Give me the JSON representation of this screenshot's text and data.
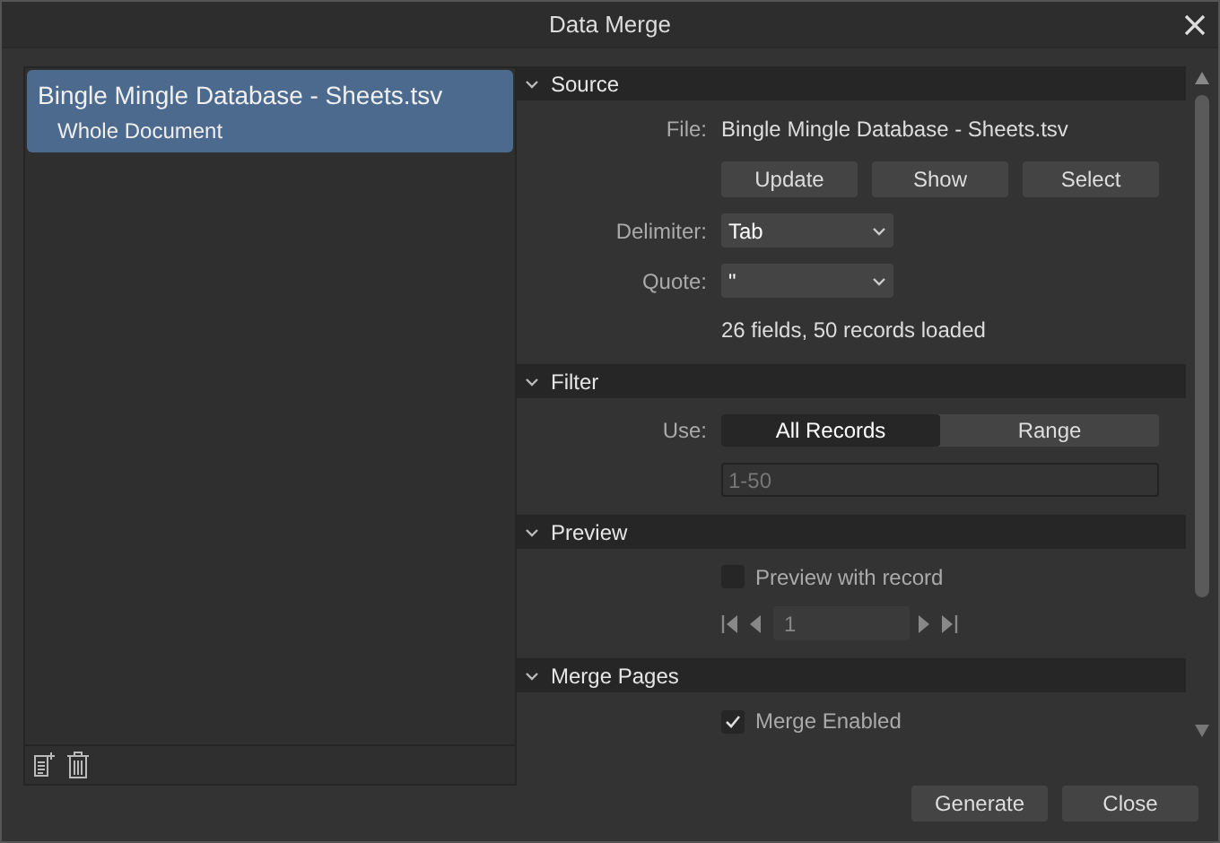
{
  "window": {
    "title": "Data Merge"
  },
  "documents": [
    {
      "name": "Bingle Mingle Database - Sheets.tsv",
      "subtitle": "Whole Document",
      "selected": true
    }
  ],
  "source": {
    "header": "Source",
    "expanded": true,
    "file_label": "File:",
    "file_value": "Bingle Mingle Database - Sheets.tsv",
    "buttons": [
      "Update",
      "Show",
      "Select"
    ],
    "delimiter_label": "Delimiter:",
    "delimiter_value": "Tab",
    "quote_label": "Quote:",
    "quote_value": "\"",
    "status": "26 fields, 50 records loaded"
  },
  "filter": {
    "header": "Filter",
    "expanded": true,
    "use_label": "Use:",
    "options": [
      {
        "label": "All Records",
        "selected": true
      },
      {
        "label": "Range",
        "selected": false
      }
    ],
    "range_value": "1-50",
    "range_disabled": true
  },
  "preview": {
    "header": "Preview",
    "expanded": true,
    "checkbox": {
      "label": "Preview with record",
      "checked": false
    },
    "record": "1"
  },
  "merge_pages": {
    "header": "Merge Pages",
    "expanded": true,
    "checkbox": {
      "label": "Merge Enabled",
      "checked": true
    }
  },
  "footer_buttons": [
    "Generate",
    "Close"
  ]
}
